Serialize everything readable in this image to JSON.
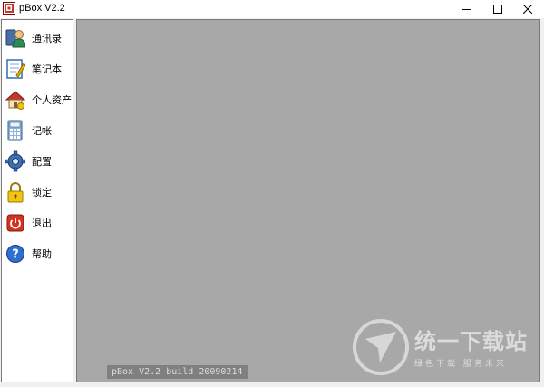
{
  "window": {
    "title": "pBox V2.2"
  },
  "sidebar": {
    "items": [
      {
        "label": "通讯录",
        "icon": "address-book-icon"
      },
      {
        "label": "笔记本",
        "icon": "notebook-icon"
      },
      {
        "label": "个人资产",
        "icon": "home-assets-icon"
      },
      {
        "label": "记帐",
        "icon": "calculator-icon"
      },
      {
        "label": "配置",
        "icon": "gear-icon"
      },
      {
        "label": "锁定",
        "icon": "lock-icon"
      },
      {
        "label": "退出",
        "icon": "power-icon"
      },
      {
        "label": "帮助",
        "icon": "help-icon"
      }
    ]
  },
  "main": {
    "build_label": "pBox V2.2 build 20090214",
    "watermark_title": "统一下载站",
    "watermark_subtitle": "绿色下载 服务未来"
  },
  "colors": {
    "content_bg": "#a8a8a8",
    "build_label_bg": "#808080"
  }
}
